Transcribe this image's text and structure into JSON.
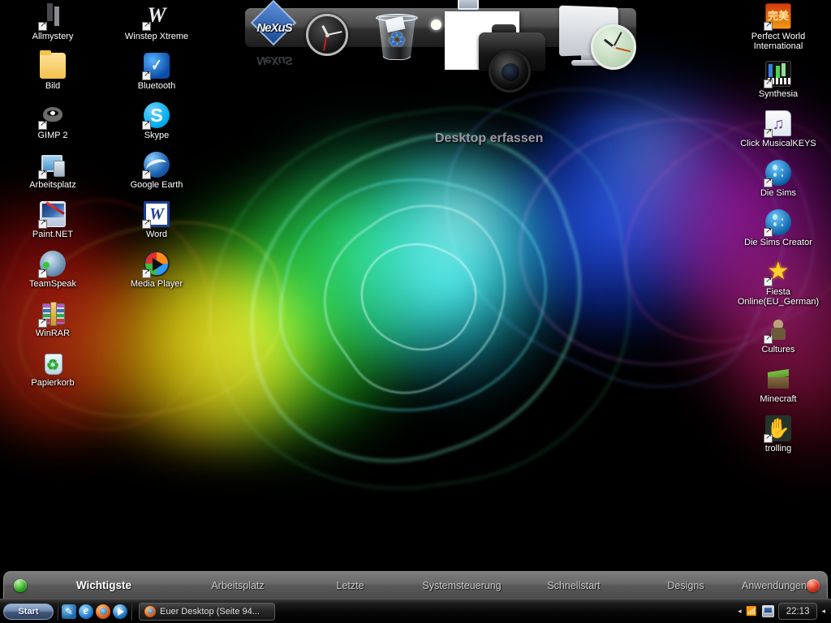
{
  "desktop": {
    "capture_tooltip": "Desktop erfassen",
    "columns": {
      "left": [
        {
          "label": "Allmystery",
          "icon": "allmystery-icon",
          "shortcut": true
        },
        {
          "label": "Bild",
          "icon": "folder-icon",
          "shortcut": false
        },
        {
          "label": "GIMP 2",
          "icon": "gimp-icon",
          "shortcut": true
        },
        {
          "label": "Arbeitsplatz",
          "icon": "my-computer-icon",
          "shortcut": true
        },
        {
          "label": "Paint.NET",
          "icon": "paint-net-icon",
          "shortcut": true
        },
        {
          "label": "TeamSpeak",
          "icon": "teamspeak-icon",
          "shortcut": true
        },
        {
          "label": "WinRAR",
          "icon": "winrar-icon",
          "shortcut": true
        },
        {
          "label": "Papierkorb",
          "icon": "recycle-bin-icon",
          "shortcut": false
        }
      ],
      "middle": [
        {
          "label": "Winstep Xtreme",
          "icon": "winstep-xtreme-icon",
          "shortcut": true
        },
        {
          "label": "Bluetooth",
          "icon": "bluetooth-icon",
          "shortcut": true
        },
        {
          "label": "Skype",
          "icon": "skype-icon",
          "shortcut": true
        },
        {
          "label": "Google Earth",
          "icon": "google-earth-icon",
          "shortcut": true
        },
        {
          "label": "Word",
          "icon": "word-icon",
          "shortcut": true
        },
        {
          "label": "Media Player",
          "icon": "media-player-icon",
          "shortcut": true
        }
      ],
      "right": [
        {
          "label": "Perfect World International",
          "icon": "perfect-world-icon",
          "shortcut": true
        },
        {
          "label": "Synthesia",
          "icon": "synthesia-icon",
          "shortcut": true
        },
        {
          "label": "Click MusicalKEYS",
          "icon": "musical-keys-icon",
          "shortcut": true
        },
        {
          "label": "Die Sims",
          "icon": "die-sims-icon",
          "shortcut": true
        },
        {
          "label": "Die Sims Creator",
          "icon": "die-sims-creator-icon",
          "shortcut": true
        },
        {
          "label": "Fiesta Online(EU_German)",
          "icon": "fiesta-online-icon",
          "shortcut": true
        },
        {
          "label": "Cultures",
          "icon": "cultures-icon",
          "shortcut": true
        },
        {
          "label": "Minecraft",
          "icon": "minecraft-icon",
          "shortcut": false
        },
        {
          "label": "trolling",
          "icon": "trolling-icon",
          "shortcut": true
        }
      ]
    }
  },
  "dock": {
    "nexus_label": "NeXuS",
    "items": [
      {
        "name": "nexus-logo",
        "label": "NeXuS"
      },
      {
        "name": "analog-clock",
        "label": "Uhr"
      },
      {
        "name": "recycle-bin",
        "label": "Papierkorb"
      },
      {
        "name": "screen-capture",
        "label": "Desktop erfassen"
      },
      {
        "name": "monitor-clock",
        "label": "Monitor"
      }
    ]
  },
  "menubar": {
    "left_orb": "start-orb-green",
    "right_orb": "power-orb-red",
    "items": [
      {
        "label": "Wichtigste",
        "active": true
      },
      {
        "label": "Arbeitsplatz",
        "active": false
      },
      {
        "label": "Letzte",
        "active": false
      },
      {
        "label": "Systemsteuerung",
        "active": false
      },
      {
        "label": "Schnellstart",
        "active": false
      },
      {
        "label": "Designs",
        "active": false
      },
      {
        "label": "Anwendungen",
        "active": false
      }
    ]
  },
  "taskbar": {
    "start_label": "Start",
    "quicklaunch": [
      {
        "name": "outlook-express-icon"
      },
      {
        "name": "internet-explorer-icon"
      },
      {
        "name": "firefox-icon"
      },
      {
        "name": "windows-media-player-icon"
      }
    ],
    "tasks": [
      {
        "label": "Euer Desktop (Seite 94...",
        "icon": "firefox-icon"
      }
    ],
    "tray": {
      "expand_left": "◂",
      "expand_right": "◂",
      "icons": [
        {
          "name": "network-icon"
        },
        {
          "name": "display-icon"
        }
      ],
      "clock": "22:13"
    }
  },
  "colors": {
    "wallpaper_base": "#000000",
    "swirl_green": "#2ee02e",
    "swirl_cyan": "#2fe8e8",
    "swirl_blue": "#2a5cff",
    "swirl_magenta": "#d028d0",
    "swirl_red": "#d81a1a",
    "swirl_yellow": "#e8e020",
    "menubar_bg": "#6a6a6a",
    "taskbar_bg": "#0a0a0a",
    "start_blue": "#6d86ab",
    "orb_green": "#26a716",
    "orb_red": "#d62a12"
  }
}
